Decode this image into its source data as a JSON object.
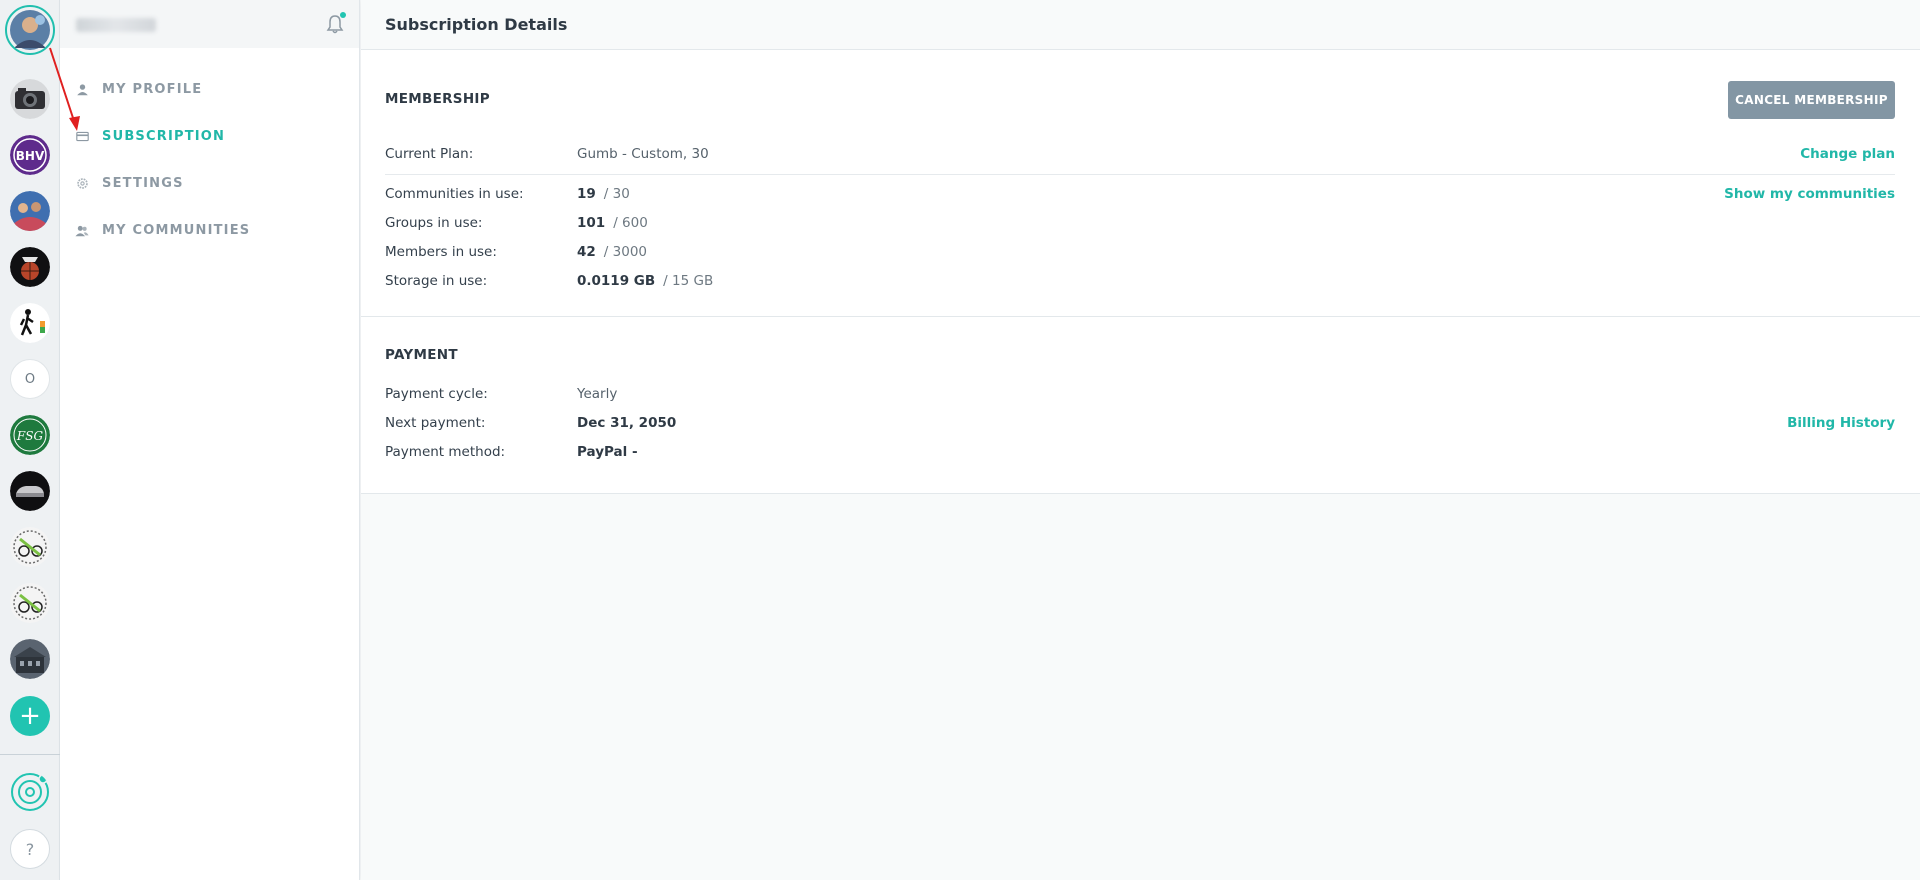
{
  "colors": {
    "accent": "#21c4b1",
    "active_text": "#21b7a8",
    "cancel_button_bg": "#8396a4",
    "annotation_arrow": "#e02020"
  },
  "rail": {
    "avatars": [
      {
        "name": "profile-avatar",
        "icon": "user-photo"
      },
      {
        "name": "community-camera",
        "icon": "camera"
      },
      {
        "name": "community-bhv",
        "icon": "bhv-logo",
        "text": "BHV"
      },
      {
        "name": "community-team-photo",
        "icon": "team-photo"
      },
      {
        "name": "community-basketball",
        "icon": "basketball"
      },
      {
        "name": "community-hiker",
        "icon": "hiker"
      },
      {
        "name": "community-o",
        "icon": "letter",
        "text": "O"
      },
      {
        "name": "community-fsg",
        "icon": "fsg-logo",
        "text": "FSG"
      },
      {
        "name": "community-car",
        "icon": "car"
      },
      {
        "name": "community-cycling-1",
        "icon": "cycling-logo"
      },
      {
        "name": "community-cycling-2",
        "icon": "cycling-logo"
      },
      {
        "name": "community-building",
        "icon": "building-photo"
      }
    ],
    "add_label": "+",
    "help_label": "?"
  },
  "sidebar": {
    "items": [
      {
        "label": "MY PROFILE",
        "icon": "person-icon"
      },
      {
        "label": "SUBSCRIPTION",
        "icon": "card-icon",
        "active": true
      },
      {
        "label": "SETTINGS",
        "icon": "gear-icon"
      },
      {
        "label": "MY COMMUNITIES",
        "icon": "people-icon"
      }
    ]
  },
  "main": {
    "title": "Subscription Details",
    "membership": {
      "title": "MEMBERSHIP",
      "cancel_label": "CANCEL MEMBERSHIP",
      "current_plan": {
        "label": "Current Plan:",
        "value": "Gumb - Custom, 30",
        "link": "Change plan"
      },
      "communities": {
        "label": "Communities in use:",
        "used": "19",
        "limit": "/ 30",
        "link": "Show my communities"
      },
      "groups": {
        "label": "Groups in use:",
        "used": "101",
        "limit": "/ 600"
      },
      "members": {
        "label": "Members in use:",
        "used": "42",
        "limit": "/ 3000"
      },
      "storage": {
        "label": "Storage in use:",
        "used": "0.0119 GB",
        "limit": "/ 15 GB"
      }
    },
    "payment": {
      "title": "PAYMENT",
      "cycle": {
        "label": "Payment cycle:",
        "value": "Yearly"
      },
      "next": {
        "label": "Next payment:",
        "value": "Dec 31, 2050",
        "link": "Billing History"
      },
      "method": {
        "label": "Payment method:",
        "value": "PayPal -"
      }
    }
  }
}
